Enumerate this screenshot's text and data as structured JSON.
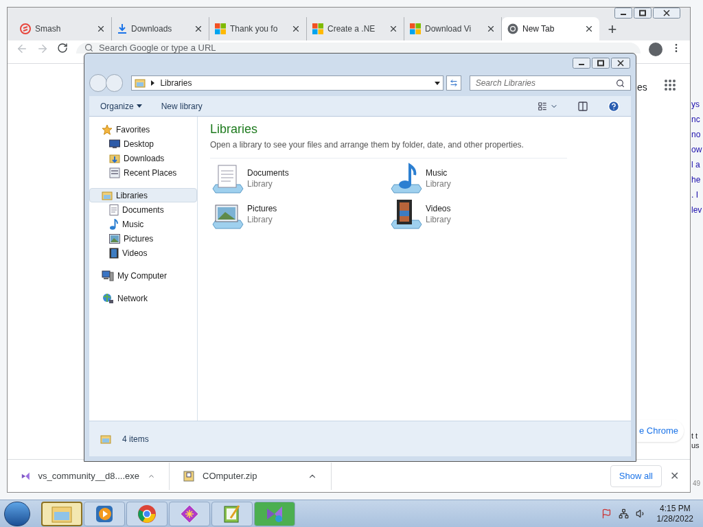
{
  "browser": {
    "tabs": [
      {
        "title": "Smash",
        "kind": "smash",
        "selected": false
      },
      {
        "title": "Downloads",
        "kind": "download",
        "selected": false
      },
      {
        "title": "Thank you fo",
        "kind": "windows",
        "selected": false
      },
      {
        "title": "Create a .NE",
        "kind": "windows",
        "selected": false
      },
      {
        "title": "Download Vi",
        "kind": "windows",
        "selected": false
      },
      {
        "title": "New Tab",
        "kind": "chrome",
        "selected": true
      }
    ],
    "new_tab": "+",
    "omnibox": {
      "placeholder": "Search Google or type a URL"
    },
    "page": {
      "link": "es",
      "customize": "e Chrome",
      "fragments": [
        "ys",
        "nc",
        "no",
        "ow",
        "l a",
        "he",
        ". I",
        "lev"
      ],
      "footer_fragments": [
        "t t",
        "us"
      ]
    },
    "downloads_bar": {
      "items": [
        {
          "name": "vs_community__d8....exe",
          "kind": "installer"
        },
        {
          "name": "COmputer.zip",
          "kind": "zip"
        }
      ],
      "show_all": "Show all",
      "close": "✕"
    },
    "corner_fragment": "49"
  },
  "explorer": {
    "address": "Libraries",
    "search": {
      "placeholder": "Search Libraries"
    },
    "toolbar": [
      {
        "label": "Organize",
        "dropdown": true
      },
      {
        "label": "New library",
        "dropdown": false
      }
    ],
    "nav": [
      {
        "label": "Favorites",
        "kind": "star",
        "selected": false,
        "children": [
          {
            "label": "Desktop",
            "kind": "desktop"
          },
          {
            "label": "Downloads",
            "kind": "downloads"
          },
          {
            "label": "Recent Places",
            "kind": "recent"
          }
        ]
      },
      {
        "label": "Libraries",
        "kind": "library",
        "selected": true,
        "children": [
          {
            "label": "Documents",
            "kind": "document"
          },
          {
            "label": "Music",
            "kind": "music"
          },
          {
            "label": "Pictures",
            "kind": "pictures"
          },
          {
            "label": "Videos",
            "kind": "videos"
          }
        ]
      },
      {
        "label": "My Computer",
        "kind": "computer",
        "selected": false
      },
      {
        "label": "Network",
        "kind": "network",
        "selected": false
      }
    ],
    "heading": "Libraries",
    "description": "Open a library to see your files and arrange them by folder, date, and other properties.",
    "libraries": [
      {
        "name": "Documents",
        "type": "Library",
        "kind": "document"
      },
      {
        "name": "Music",
        "type": "Library",
        "kind": "music"
      },
      {
        "name": "Pictures",
        "type": "Library",
        "kind": "pictures"
      },
      {
        "name": "Videos",
        "type": "Library",
        "kind": "videos"
      }
    ],
    "status": "4 items"
  },
  "taskbar": {
    "apps": [
      {
        "kind": "explorer",
        "selected": true,
        "attention": false
      },
      {
        "kind": "media",
        "selected": false,
        "attention": false
      },
      {
        "kind": "chrome",
        "selected": false,
        "attention": false
      },
      {
        "kind": "sparkle",
        "selected": false,
        "attention": false
      },
      {
        "kind": "notepad",
        "selected": false,
        "attention": false
      },
      {
        "kind": "installer",
        "selected": false,
        "attention": true
      }
    ],
    "time": "4:15 PM",
    "date": "1/28/2022"
  }
}
